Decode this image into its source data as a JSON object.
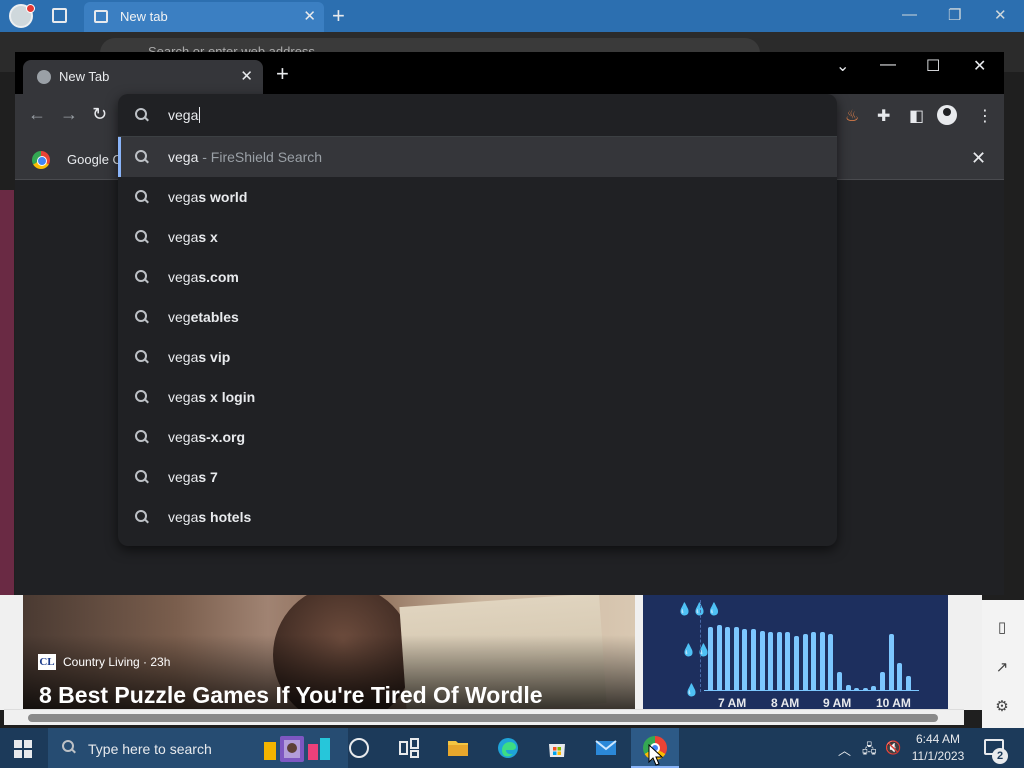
{
  "edge": {
    "tab_title": "New tab",
    "address_placeholder": "Search or enter web address",
    "news": {
      "source": "Country Living · 23h",
      "source_logo": "CL",
      "headline": "8 Best Puzzle Games If You're Tired Of Wordle"
    },
    "weather": {
      "time_labels": [
        "7 AM",
        "8 AM",
        "9 AM",
        "10 AM"
      ],
      "precip_levels": [
        0.7,
        0.72,
        0.7,
        0.7,
        0.68,
        0.68,
        0.66,
        0.64,
        0.64,
        0.64,
        0.6,
        0.62,
        0.64,
        0.64,
        0.62,
        0.2,
        0.05,
        0.02,
        0.02,
        0.04,
        0.2,
        0.62,
        0.3,
        0.15
      ],
      "bar_color": "#7cc7ff"
    }
  },
  "chrome": {
    "tab_title": "New Tab",
    "bookmark_label": "Google C",
    "omnibox": {
      "query": "vega",
      "suggestions": [
        {
          "typed": "vega",
          "completion": "",
          "sub": " - FireShield Search"
        },
        {
          "typed": "vega",
          "completion": "s world",
          "sub": ""
        },
        {
          "typed": "vega",
          "completion": "s x",
          "sub": ""
        },
        {
          "typed": "vega",
          "completion": "s.com",
          "sub": ""
        },
        {
          "typed": "veg",
          "completion": "etables",
          "sub": ""
        },
        {
          "typed": "vega",
          "completion": "s vip",
          "sub": ""
        },
        {
          "typed": "vega",
          "completion": "s x login",
          "sub": ""
        },
        {
          "typed": "vega",
          "completion": "s-x.org",
          "sub": ""
        },
        {
          "typed": "vega",
          "completion": "s 7",
          "sub": ""
        },
        {
          "typed": "vega",
          "completion": "s hotels",
          "sub": ""
        }
      ]
    }
  },
  "taskbar": {
    "search_placeholder": "Type here to search",
    "time": "6:44 AM",
    "date": "11/1/2023",
    "notification_count": "2"
  },
  "colors": {
    "edge_titlebar": "#2c6fb0",
    "taskbar": "#1c3a5a",
    "chrome_frame": "#000000",
    "chrome_toolbar": "#35363a",
    "omnibox_bg": "#202124",
    "accent": "#8ab4f8"
  }
}
